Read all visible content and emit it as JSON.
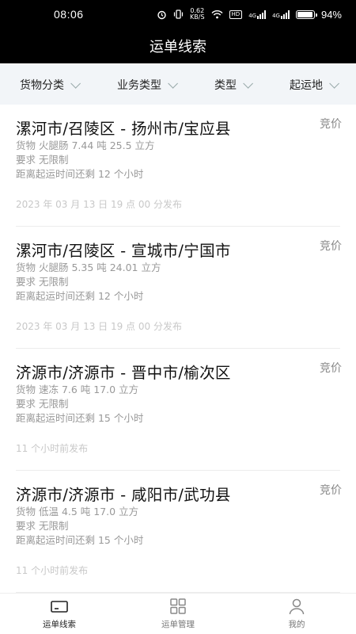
{
  "status_bar": {
    "time": "08:06",
    "net_speed_value": "0.62",
    "net_speed_unit": "KB/S",
    "hd_badge": "HD",
    "signal_1": "4G",
    "signal_2": "4G",
    "battery": "94%"
  },
  "header": {
    "title": "运单线索"
  },
  "filters": [
    {
      "label": "货物分类"
    },
    {
      "label": "业务类型"
    },
    {
      "label": "类型"
    },
    {
      "label": "起运地"
    }
  ],
  "orders": [
    {
      "route": "漯河市/召陵区 - 扬州市/宝应县",
      "bid_label": "竞价",
      "cargo": "货物 火腿肠 7.44 吨 25.5 立方",
      "requirement": "要求 无限制",
      "remaining": "距离起运时间还剩 12 个小时",
      "published": "2023 年 03 月 13 日 19 点 00 分发布"
    },
    {
      "route": "漯河市/召陵区 - 宣城市/宁国市",
      "bid_label": "竞价",
      "cargo": "货物 火腿肠 5.35 吨 24.01 立方",
      "requirement": "要求 无限制",
      "remaining": "距离起运时间还剩 12 个小时",
      "published": "2023 年 03 月 13 日 19 点 00 分发布"
    },
    {
      "route": "济源市/济源市 - 晋中市/榆次区",
      "bid_label": "竞价",
      "cargo": "货物 速冻 7.6 吨 17.0 立方",
      "requirement": "要求 无限制",
      "remaining": "距离起运时间还剩 15 个小时",
      "published": "11 个小时前发布"
    },
    {
      "route": "济源市/济源市 - 咸阳市/武功县",
      "bid_label": "竞价",
      "cargo": "货物 低温 4.5 吨 17.0 立方",
      "requirement": "要求 无限制",
      "remaining": "距离起运时间还剩 15 个小时",
      "published": "11 个小时前发布"
    }
  ],
  "tab_bar": [
    {
      "label": "运单线索",
      "icon": "waybill-icon",
      "active": true
    },
    {
      "label": "运单管理",
      "icon": "grid-icon",
      "active": false
    },
    {
      "label": "我的",
      "icon": "user-icon",
      "active": false
    }
  ]
}
